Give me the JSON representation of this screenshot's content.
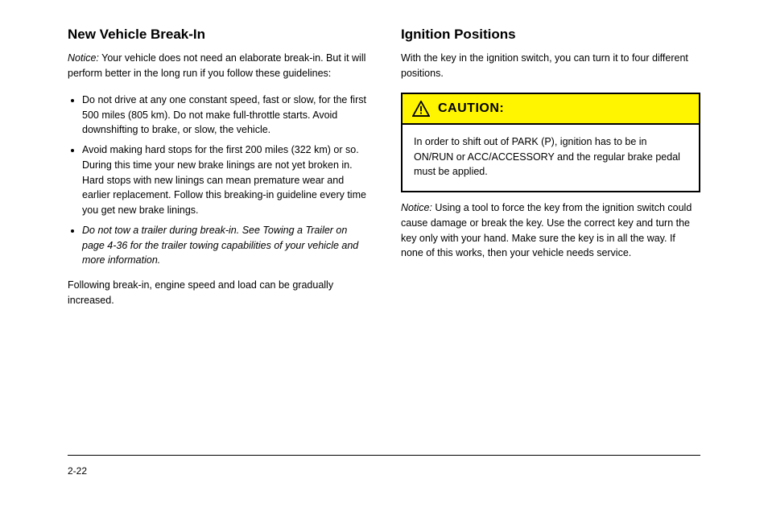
{
  "left": {
    "heading": "New Vehicle Break-In",
    "notice_label": "Notice:",
    "notice_text": " Your vehicle does not need an elaborate break-in. But it will perform better in the long run if you follow these guidelines:",
    "bullets": [
      "Do not drive at any one constant speed, fast or slow, for the first 500 miles (805 km). Do not make full-throttle starts. Avoid downshifting to brake, or slow, the vehicle.",
      "Avoid making hard stops for the first 200 miles (322 km) or so. During this time your new brake linings are not yet broken in. Hard stops with new linings can mean premature wear and earlier replacement. Follow this breaking-in guideline every time you get new brake linings.",
      "Do not tow a trailer during break-in. See Towing a Trailer on page 4-36 for the trailer towing capabilities of your vehicle and more information."
    ],
    "closing": "Following break-in, engine speed and load can be gradually increased."
  },
  "right": {
    "heading": "Ignition Positions",
    "intro": "With the key in the ignition switch, you can turn it to four different positions.",
    "caution_label": "CAUTION:",
    "caution_body": "In order to shift out of PARK (P), ignition has to be in ON/RUN or ACC/ACCESSORY and the regular brake pedal must be applied.",
    "notice_label": "Notice:",
    "notice_text": " Using a tool to force the key from the ignition switch could cause damage or break the key. Use the correct key and turn the key only with your hand. Make sure the key is in all the way. If none of this works, then your vehicle needs service."
  },
  "page_number": "2-22"
}
